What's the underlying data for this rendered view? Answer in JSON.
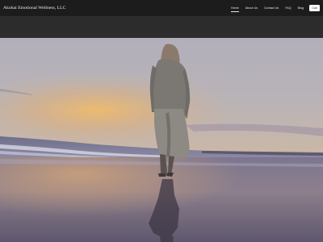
{
  "site": {
    "title": "Akohai Emotional Wellness, LLC"
  },
  "nav": {
    "items": [
      {
        "label": "Home",
        "active": true
      },
      {
        "label": "About Us",
        "active": false
      },
      {
        "label": "Contact Us",
        "active": false
      },
      {
        "label": "FAQ",
        "active": false
      },
      {
        "label": "Blog",
        "active": false
      }
    ],
    "cta_label": "Call"
  },
  "hero": {
    "image": "woman-walking-on-beach-at-sunset",
    "colors": {
      "sky": "#b4b1bc",
      "sun": "#e7b46a",
      "sand": "#6f6680"
    }
  },
  "colors": {
    "topbar": "#1c1c1c",
    "strip": "#2c2c2c",
    "text": "#f2f2f2",
    "cta_bg": "#ffffff"
  }
}
